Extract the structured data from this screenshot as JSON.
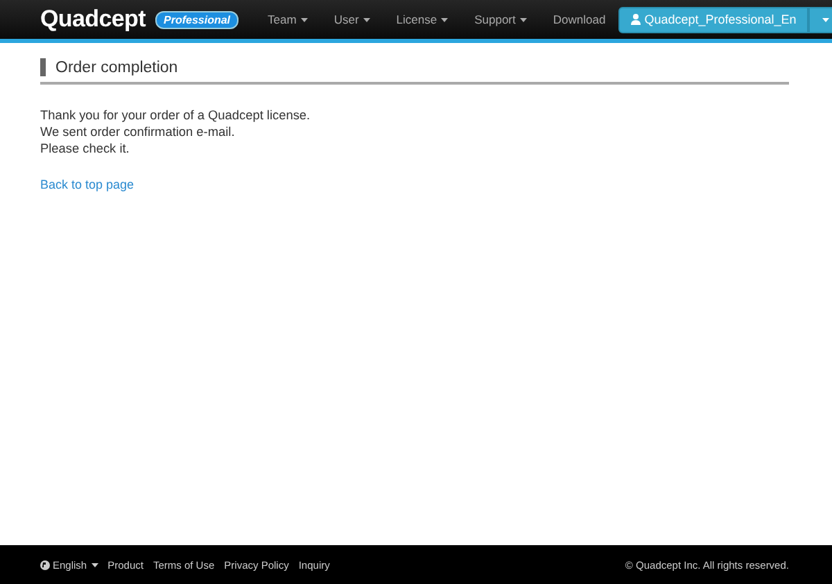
{
  "header": {
    "logo": "Quadcept",
    "edition_badge": "Professional",
    "nav": [
      {
        "label": "Team",
        "dropdown": true
      },
      {
        "label": "User",
        "dropdown": true
      },
      {
        "label": "License",
        "dropdown": true
      },
      {
        "label": "Support",
        "dropdown": true
      },
      {
        "label": "Download",
        "dropdown": false
      }
    ],
    "account_button": "Quadcept_Professional_En"
  },
  "page": {
    "title": "Order completion",
    "message_lines": [
      "Thank you for your order of a Quadcept license.",
      "We sent order confirmation e-mail.",
      "Please check it."
    ],
    "link": "Back to top page"
  },
  "footer": {
    "language": "English",
    "links": [
      "Product",
      "Terms of Use",
      "Privacy Policy",
      "Inquiry"
    ],
    "copyright": "© Quadcept Inc. All rights reserved."
  }
}
